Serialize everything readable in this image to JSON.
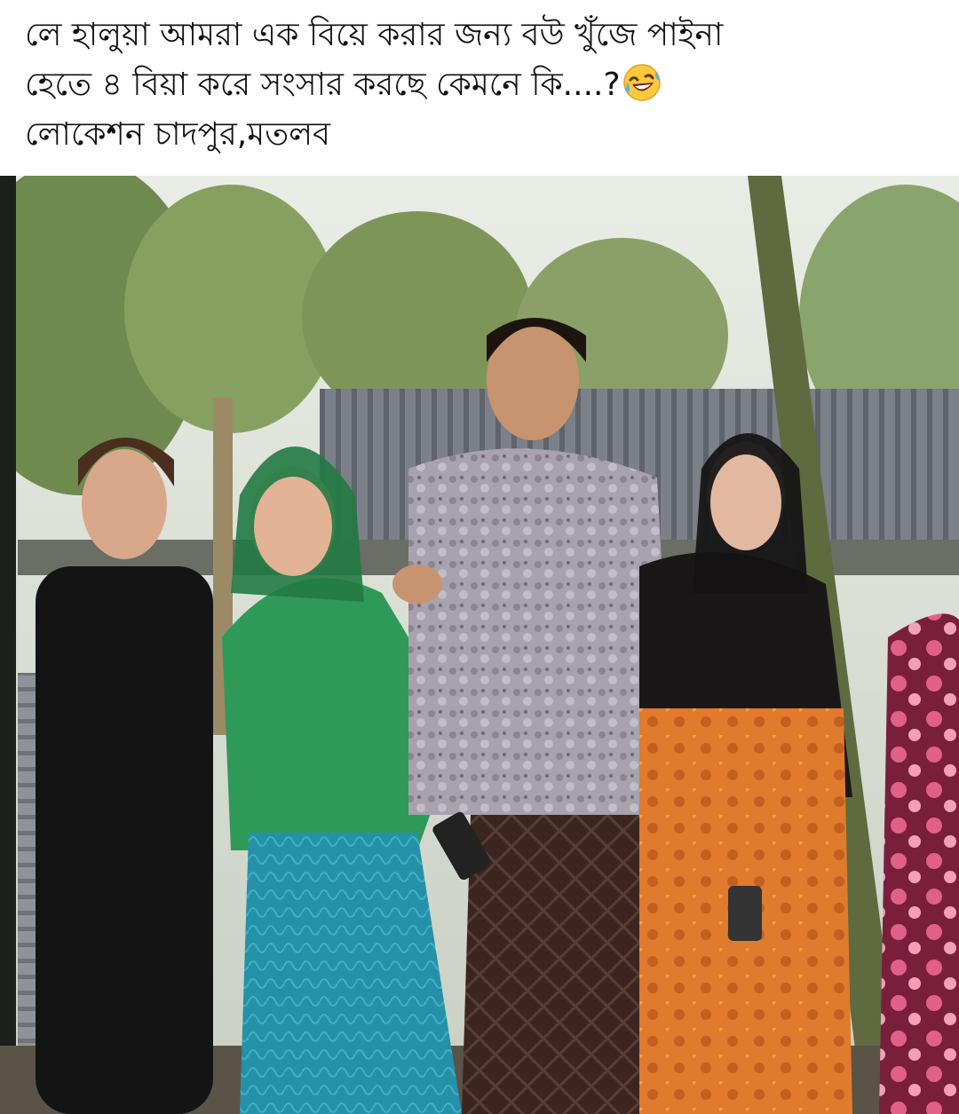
{
  "caption": {
    "line1": "লে হালুয়া আমরা এক বিয়ে করার জন্য বউ খুঁজে পাইনা",
    "line2": "হেতে ৪ বিয়া করে সংসার করছে কেমনে কি....?",
    "line3": "লোকেশন চাদপুর,মতলব",
    "emoji": "rolling-on-floor-laughing-emoji"
  },
  "photo": {
    "subject": "group-photo"
  }
}
